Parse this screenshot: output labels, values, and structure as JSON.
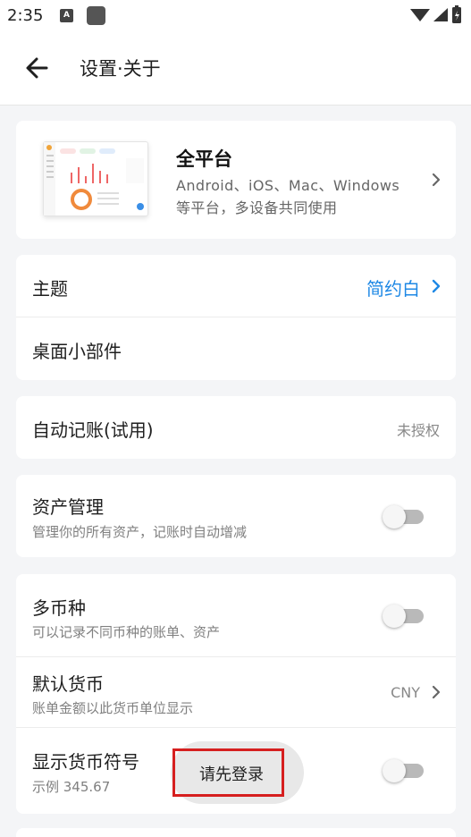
{
  "status_bar": {
    "time": "2:35",
    "notif_icon_letter": "A"
  },
  "header": {
    "title": "设置·关于"
  },
  "promo": {
    "title": "全平台",
    "subtitle_line1": "Android、iOS、Mac、Windows",
    "subtitle_line2": "等平台，多设备共同使用"
  },
  "appearance": {
    "theme_label": "主题",
    "theme_value": "简约白",
    "widget_label": "桌面小部件"
  },
  "auto_bookkeeping": {
    "label": "自动记账(试用)",
    "value": "未授权"
  },
  "assets": {
    "title": "资产管理",
    "subtitle": "管理你的所有资产，记账时自动增减",
    "enabled": false
  },
  "currency": {
    "multi_title": "多币种",
    "multi_subtitle": "可以记录不同币种的账单、资产",
    "multi_enabled": false,
    "default_title": "默认货币",
    "default_subtitle": "账单金额以此货币单位显示",
    "default_value": "CNY",
    "symbol_title": "显示货币符号",
    "symbol_subtitle": "示例 345.67",
    "symbol_enabled": false
  },
  "toast": {
    "text": "请先登录"
  },
  "colors": {
    "accent": "#1e88e5",
    "highlight": "#d61f1f",
    "background": "#f4f5f7"
  }
}
